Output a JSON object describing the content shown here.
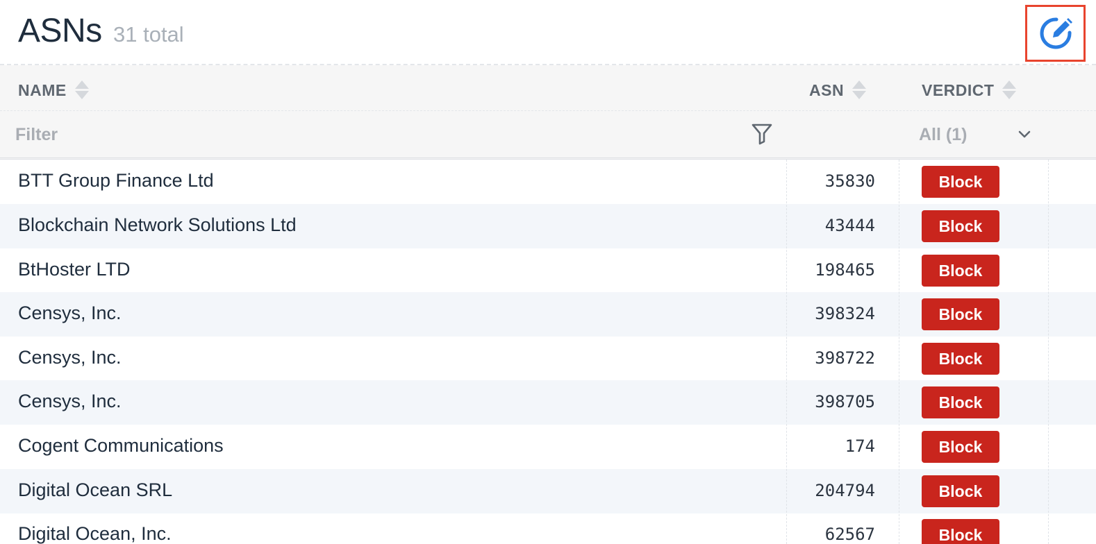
{
  "header": {
    "title": "ASNs",
    "total": "31 total",
    "accent_color": "#2a7de1",
    "edit_icon": "edit-icon"
  },
  "table": {
    "columns": [
      {
        "key": "name",
        "label": "NAME"
      },
      {
        "key": "asn",
        "label": "ASN"
      },
      {
        "key": "verdict",
        "label": "VERDICT"
      }
    ],
    "filter": {
      "name_placeholder": "Filter",
      "verdict_selected": "All (1)"
    },
    "verdict_color": "#c9251d",
    "rows": [
      {
        "name": "BTT Group Finance Ltd",
        "asn": "35830",
        "verdict": "Block"
      },
      {
        "name": "Blockchain Network Solutions Ltd",
        "asn": "43444",
        "verdict": "Block"
      },
      {
        "name": "BtHoster LTD",
        "asn": "198465",
        "verdict": "Block"
      },
      {
        "name": "Censys, Inc.",
        "asn": "398324",
        "verdict": "Block"
      },
      {
        "name": "Censys, Inc.",
        "asn": "398722",
        "verdict": "Block"
      },
      {
        "name": "Censys, Inc.",
        "asn": "398705",
        "verdict": "Block"
      },
      {
        "name": "Cogent Communications",
        "asn": "174",
        "verdict": "Block"
      },
      {
        "name": "Digital Ocean SRL",
        "asn": "204794",
        "verdict": "Block"
      },
      {
        "name": "Digital Ocean, Inc.",
        "asn": "62567",
        "verdict": "Block"
      }
    ]
  }
}
